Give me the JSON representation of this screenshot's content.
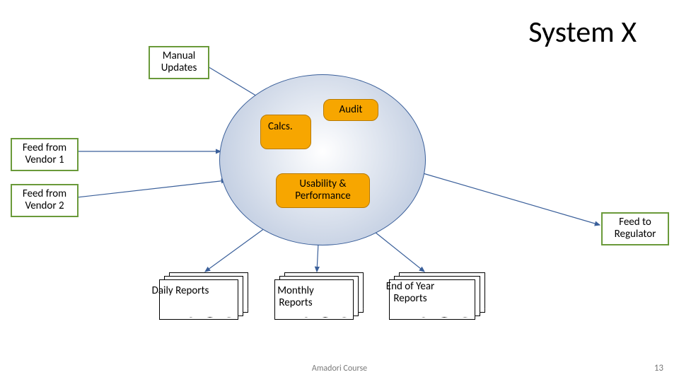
{
  "title": "System X",
  "inputs": {
    "manual": "Manual Updates",
    "v1": "Feed from Vendor 1",
    "v2": "Feed from Vendor 2"
  },
  "outputs": {
    "reg": "Feed to Regulator"
  },
  "core": {
    "calcs": "Calcs.",
    "audit": "Audit",
    "up": "Usability & Performance"
  },
  "reports": {
    "daily": "Daily Reports",
    "monthly": "Monthly Reports",
    "eoy": "End of Year Reports"
  },
  "footer": {
    "course": "Amadori Course",
    "page": "13"
  }
}
